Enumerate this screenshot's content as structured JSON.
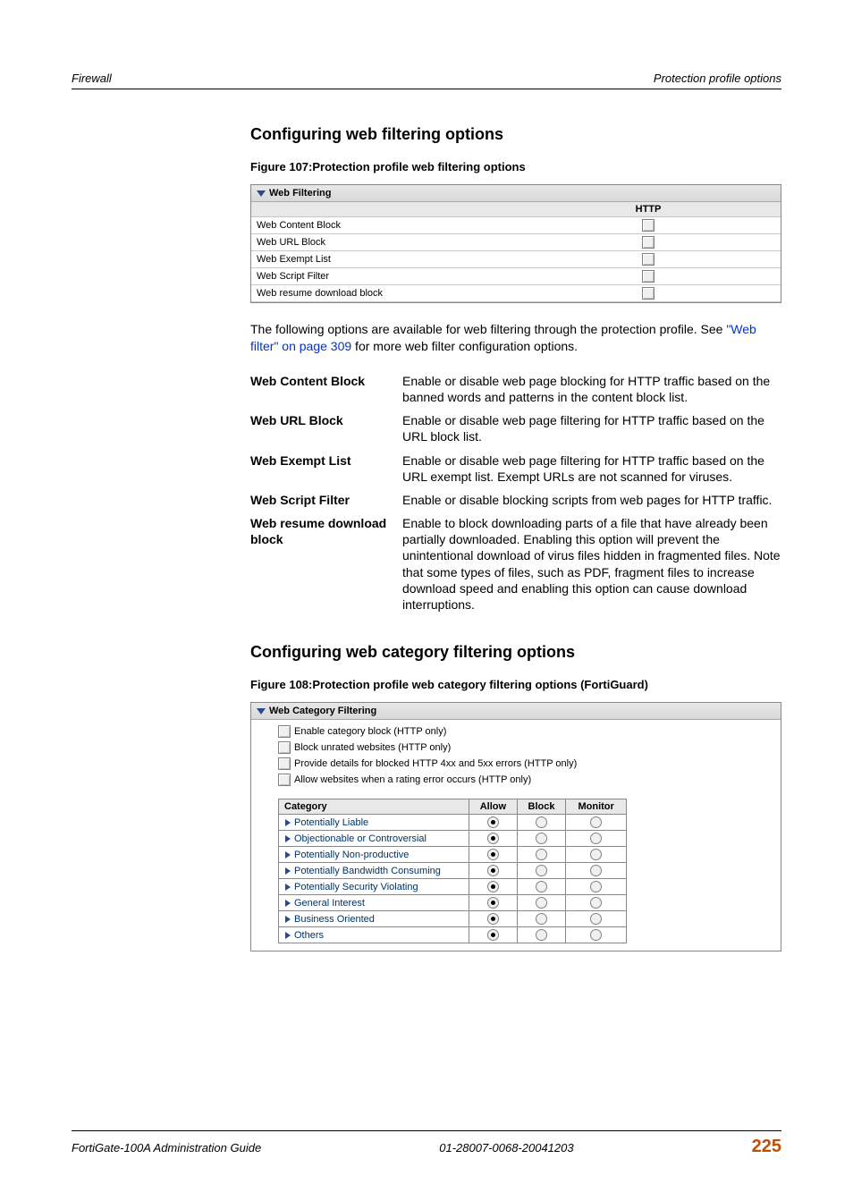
{
  "header": {
    "left": "Firewall",
    "right": "Protection profile options"
  },
  "section1": {
    "heading": "Configuring web filtering options",
    "figure_caption": "Figure 107:Protection profile web filtering options",
    "panel_title": "Web Filtering",
    "col_header": "HTTP",
    "rows": [
      "Web Content Block",
      "Web URL Block",
      "Web Exempt List",
      "Web Script Filter",
      "Web resume download block"
    ],
    "body_pre": "The following options are available for web filtering through the protection profile. See ",
    "body_link": "\"Web filter\" on page 309",
    "body_post": " for more web filter configuration options.",
    "defs": [
      {
        "term": "Web Content Block",
        "desc": "Enable or disable web page blocking for HTTP traffic based on the banned words and patterns in the content block list."
      },
      {
        "term": "Web URL Block",
        "desc": "Enable or disable web page filtering for HTTP traffic based on the URL block list."
      },
      {
        "term": "Web Exempt List",
        "desc": "Enable or disable web page filtering for HTTP traffic based on the URL exempt list. Exempt URLs are not scanned for viruses."
      },
      {
        "term": "Web Script Filter",
        "desc": "Enable or disable blocking scripts from web pages for HTTP traffic."
      },
      {
        "term": "Web resume download block",
        "desc": "Enable to block downloading parts of a file that have already been partially downloaded. Enabling this option will prevent the unintentional download of virus files hidden in fragmented files. Note that some types of files, such as PDF, fragment files to increase download speed and enabling this option can cause download interruptions."
      }
    ]
  },
  "section2": {
    "heading": "Configuring web category filtering options",
    "figure_caption": "Figure 108:Protection profile web category filtering options (FortiGuard)",
    "panel_title": "Web Category Filtering",
    "options": [
      "Enable category block (HTTP only)",
      "Block unrated websites (HTTP only)",
      "Provide details for blocked HTTP 4xx and 5xx errors (HTTP only)",
      "Allow websites when a rating error occurs (HTTP only)"
    ],
    "cat_headers": [
      "Category",
      "Allow",
      "Block",
      "Monitor"
    ],
    "categories": [
      "Potentially Liable",
      "Objectionable or Controversial",
      "Potentially Non-productive",
      "Potentially Bandwidth Consuming",
      "Potentially Security Violating",
      "General Interest",
      "Business Oriented",
      "Others"
    ]
  },
  "footer": {
    "left": "FortiGate-100A Administration Guide",
    "center": "01-28007-0068-20041203",
    "page": "225"
  }
}
